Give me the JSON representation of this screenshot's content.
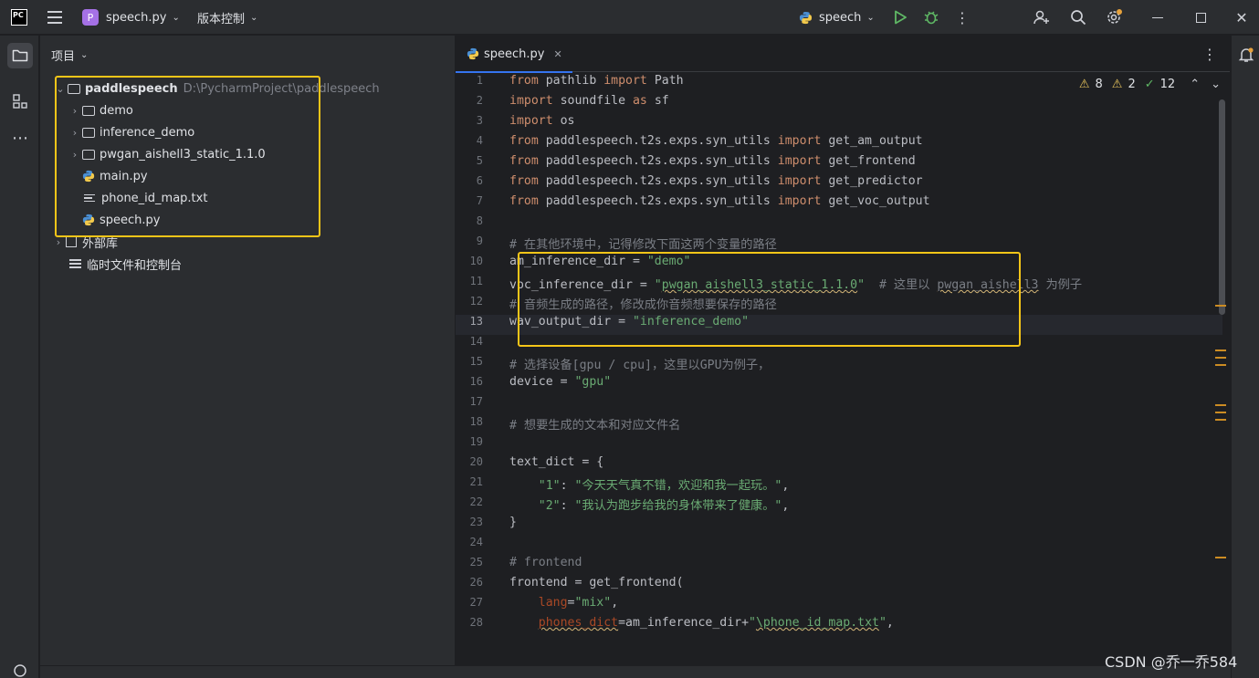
{
  "titlebar": {
    "logo": "PC",
    "project_badge": "P",
    "project_name": "speech.py",
    "vcs_label": "版本控制",
    "run_config": "speech",
    "icons": [
      "menu-icon",
      "python-icon",
      "run-icon",
      "debug-icon",
      "more-icon",
      "add-user-icon",
      "search-icon",
      "settings-icon",
      "minimize-icon",
      "maximize-icon",
      "close-icon"
    ]
  },
  "project_panel": {
    "title": "项目",
    "root": {
      "name": "paddlespeech",
      "path": "D:\\PycharmProject\\paddlespeech"
    },
    "items": [
      {
        "type": "folder",
        "name": "demo"
      },
      {
        "type": "folder",
        "name": "inference_demo"
      },
      {
        "type": "folder",
        "name": "pwgan_aishell3_static_1.1.0"
      },
      {
        "type": "python",
        "name": "main.py"
      },
      {
        "type": "text",
        "name": "phone_id_map.txt"
      },
      {
        "type": "python",
        "name": "speech.py"
      }
    ],
    "external_libs": "外部库",
    "scratches": "临时文件和控制台"
  },
  "editor": {
    "tab_name": "speech.py",
    "inspections": {
      "warnings": "8",
      "weak_warnings": "2",
      "typos": "12"
    },
    "current_line": 13,
    "line_numbers": [
      "1",
      "2",
      "3",
      "4",
      "5",
      "6",
      "7",
      "8",
      "9",
      "10",
      "11",
      "12",
      "13",
      "14",
      "15",
      "16",
      "17",
      "18",
      "19",
      "20",
      "21",
      "22",
      "23",
      "24",
      "25",
      "26",
      "27",
      "28"
    ],
    "lines": [
      [
        {
          "t": "from",
          "c": "kw"
        },
        {
          "t": " pathlib "
        },
        {
          "t": "import",
          "c": "kw"
        },
        {
          "t": " Path"
        }
      ],
      [
        {
          "t": "import",
          "c": "kw"
        },
        {
          "t": " soundfile "
        },
        {
          "t": "as",
          "c": "kw"
        },
        {
          "t": " sf"
        }
      ],
      [
        {
          "t": "import",
          "c": "kw"
        },
        {
          "t": " os"
        }
      ],
      [
        {
          "t": "from",
          "c": "kw"
        },
        {
          "t": " paddlespeech.t2s.exps.syn_utils "
        },
        {
          "t": "import",
          "c": "kw"
        },
        {
          "t": " get_am_output"
        }
      ],
      [
        {
          "t": "from",
          "c": "kw"
        },
        {
          "t": " paddlespeech.t2s.exps.syn_utils "
        },
        {
          "t": "import",
          "c": "kw"
        },
        {
          "t": " get_frontend"
        }
      ],
      [
        {
          "t": "from",
          "c": "kw"
        },
        {
          "t": " paddlespeech.t2s.exps.syn_utils "
        },
        {
          "t": "import",
          "c": "kw"
        },
        {
          "t": " get_predictor"
        }
      ],
      [
        {
          "t": "from",
          "c": "kw"
        },
        {
          "t": " paddlespeech.t2s.exps.syn_utils "
        },
        {
          "t": "import",
          "c": "kw"
        },
        {
          "t": " get_voc_output"
        }
      ],
      [],
      [
        {
          "t": "# 在其他环境中，记得修改下面这两个变量的路径",
          "c": "cm"
        }
      ],
      [
        {
          "t": "am_inference_dir = "
        },
        {
          "t": "\"demo\"",
          "c": "str"
        }
      ],
      [
        {
          "t": "voc_inference_dir = "
        },
        {
          "t": "\"",
          "c": "str"
        },
        {
          "t": "pwgan_aishell3_static_1.1.0",
          "c": "str wavy"
        },
        {
          "t": "\"",
          "c": "str"
        },
        {
          "t": "  # 这里以 ",
          "c": "cm"
        },
        {
          "t": "pwgan_aishell3",
          "c": "cm wavy"
        },
        {
          "t": " 为例子",
          "c": "cm"
        }
      ],
      [
        {
          "t": "# 音频生成的路径，修改成你音频想要保存的路径",
          "c": "cm"
        }
      ],
      [
        {
          "t": "wav_output_dir = "
        },
        {
          "t": "\"inference_demo\"",
          "c": "str"
        }
      ],
      [],
      [
        {
          "t": "# 选择设备[gpu / cpu]，这里以GPU为例子，",
          "c": "cm"
        }
      ],
      [
        {
          "t": "device = "
        },
        {
          "t": "\"gpu\"",
          "c": "str"
        }
      ],
      [],
      [
        {
          "t": "# 想要生成的文本和对应文件名",
          "c": "cm"
        }
      ],
      [],
      [
        {
          "t": "text_dict = {"
        }
      ],
      [
        {
          "t": "    "
        },
        {
          "t": "\"1\"",
          "c": "str"
        },
        {
          "t": ": "
        },
        {
          "t": "\"今天天气真不错，欢迎和我一起玩。\"",
          "c": "str"
        },
        {
          "t": ","
        }
      ],
      [
        {
          "t": "    "
        },
        {
          "t": "\"2\"",
          "c": "str"
        },
        {
          "t": ": "
        },
        {
          "t": "\"我认为跑步给我的身体带来了健康。\"",
          "c": "str"
        },
        {
          "t": ","
        }
      ],
      [
        {
          "t": "}"
        }
      ],
      [],
      [
        {
          "t": "# frontend",
          "c": "cm"
        }
      ],
      [
        {
          "t": "frontend = get_frontend("
        }
      ],
      [
        {
          "t": "    "
        },
        {
          "t": "lang",
          "c": "param"
        },
        {
          "t": "="
        },
        {
          "t": "\"mix\"",
          "c": "str"
        },
        {
          "t": ","
        }
      ],
      [
        {
          "t": "    "
        },
        {
          "t": "phones_dict",
          "c": "param wavy"
        },
        {
          "t": "=am_inference_dir+"
        },
        {
          "t": "\"",
          "c": "str"
        },
        {
          "t": "\\phone_id_map.txt",
          "c": "str wavy"
        },
        {
          "t": "\"",
          "c": "str"
        },
        {
          "t": ","
        }
      ]
    ]
  },
  "watermark": "CSDN @乔一乔584",
  "colors": {
    "highlight": "#f5c518",
    "accent": "#3574f0",
    "keyword": "#cf8e6d",
    "string": "#6aab73",
    "comment": "#7a7e85"
  }
}
